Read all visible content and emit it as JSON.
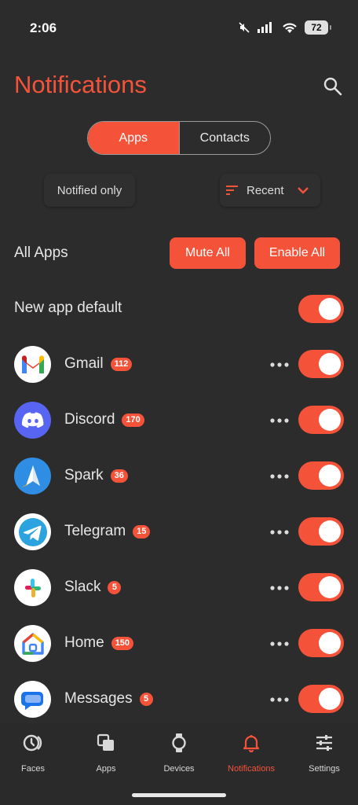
{
  "status_bar": {
    "time": "2:06",
    "battery": "72"
  },
  "header": {
    "title": "Notifications"
  },
  "tabs": [
    {
      "label": "Apps",
      "active": true
    },
    {
      "label": "Contacts",
      "active": false
    }
  ],
  "filters": {
    "notified": "Notified only",
    "sort": "Recent"
  },
  "all_apps": {
    "label": "All Apps",
    "mute_label": "Mute All",
    "enable_label": "Enable All"
  },
  "new_app_default": {
    "label": "New app default",
    "enabled": true
  },
  "apps": [
    {
      "name": "Gmail",
      "count": "112",
      "enabled": true
    },
    {
      "name": "Discord",
      "count": "170",
      "enabled": true
    },
    {
      "name": "Spark",
      "count": "36",
      "enabled": true
    },
    {
      "name": "Telegram",
      "count": "15",
      "enabled": true
    },
    {
      "name": "Slack",
      "count": "5",
      "enabled": true
    },
    {
      "name": "Home",
      "count": "150",
      "enabled": true
    },
    {
      "name": "Messages",
      "count": "5",
      "enabled": true
    }
  ],
  "nav": [
    {
      "label": "Faces",
      "icon": "faces-icon",
      "active": false
    },
    {
      "label": "Apps",
      "icon": "apps-icon",
      "active": false
    },
    {
      "label": "Devices",
      "icon": "watch-icon",
      "active": false
    },
    {
      "label": "Notifications",
      "icon": "bell-icon",
      "active": true
    },
    {
      "label": "Settings",
      "icon": "sliders-icon",
      "active": false
    }
  ],
  "colors": {
    "accent": "#f4533a",
    "background": "#2c2c2c"
  }
}
